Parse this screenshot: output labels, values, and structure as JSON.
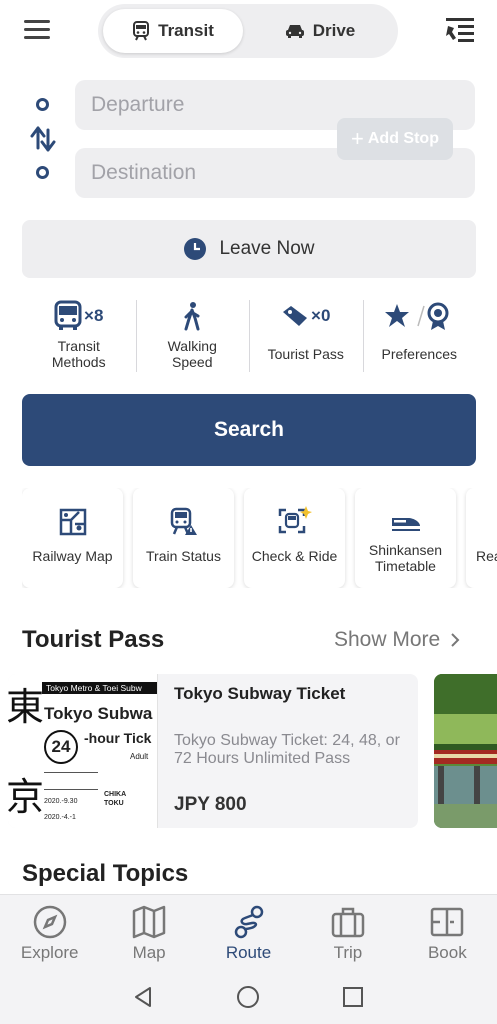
{
  "topbar": {
    "transit_label": "Transit",
    "drive_label": "Drive",
    "menu_icon": "hamburger-icon",
    "settings_icon": "filter-list-icon"
  },
  "route": {
    "departure_placeholder": "Departure",
    "destination_placeholder": "Destination",
    "add_stop_label": "Add Stop",
    "leave_now_label": "Leave Now"
  },
  "options": [
    {
      "icon": "bus-icon",
      "count": "×8",
      "label_line1": "Transit",
      "label_line2": "Methods"
    },
    {
      "icon": "walking-icon",
      "count": "",
      "label_line1": "Walking",
      "label_line2": "Speed"
    },
    {
      "icon": "ticket-icon",
      "count": "×0",
      "label_line1": "Tourist Pass",
      "label_line2": ""
    },
    {
      "icon": "star-badge-icon",
      "count": "",
      "label_line1": "Preferences",
      "label_line2": ""
    }
  ],
  "search_label": "Search",
  "tiles": [
    {
      "icon": "railway-map-icon",
      "line1": "Railway Map",
      "line2": ""
    },
    {
      "icon": "train-alert-icon",
      "line1": "Train Status",
      "line2": ""
    },
    {
      "icon": "scan-train-icon",
      "line1": "Check & Ride",
      "line2": ""
    },
    {
      "icon": "shinkansen-icon",
      "line1": "Shinkansen",
      "line2": "Timetable"
    },
    {
      "icon": "more-icon",
      "line1": "Rea",
      "line2": ""
    }
  ],
  "tourist_pass": {
    "section_title": "Tourist Pass",
    "show_more": "Show More",
    "card": {
      "name": "Tokyo Subway Ticket",
      "description": "Tokyo Subway Ticket: 24, 48, or 72 Hours Unlimited Pass",
      "price": "JPY 800",
      "ticket_header": "Tokyo Metro & Toei Subw",
      "ticket_title": "Tokyo Subwa",
      "ticket_hours": "24",
      "ticket_hour_label": "-hour Tick",
      "ticket_adult": "Adult",
      "ticket_date1": "2020.-9.30",
      "ticket_date2": "2020.-4.-1",
      "ticket_brand": "CHIKA TOKU",
      "ticket_kanji1": "東",
      "ticket_kanji2": "京"
    }
  },
  "special_topics_title": "Special Topics",
  "bottom_nav": [
    {
      "icon": "compass-icon",
      "label": "Explore"
    },
    {
      "icon": "map-icon",
      "label": "Map"
    },
    {
      "icon": "route-icon",
      "label": "Route"
    },
    {
      "icon": "suitcase-icon",
      "label": "Trip"
    },
    {
      "icon": "book-icon",
      "label": "Book"
    }
  ],
  "colors": {
    "accent": "#2d4a78",
    "field_bg": "#eeeef0"
  }
}
